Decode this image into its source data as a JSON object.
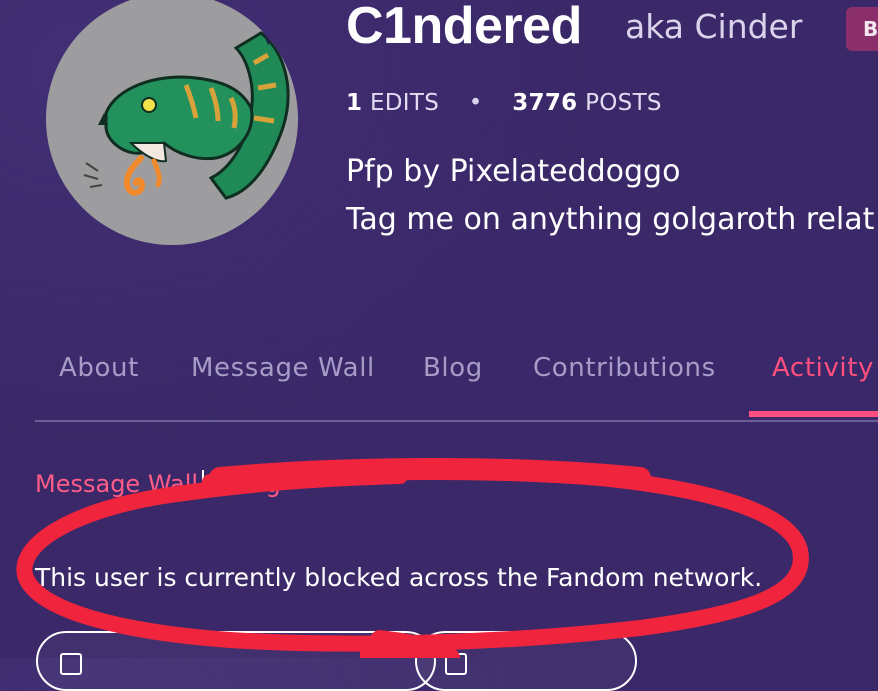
{
  "profile": {
    "username": "C1ndered",
    "aka_word": "aka",
    "aka_name": "Cinder",
    "badge": "B",
    "edits_count": "1",
    "edits_label": "EDITS",
    "separator": "•",
    "posts_count": "3776",
    "posts_label": "POSTS",
    "bio_line1": "Pfp by Pixelateddoggo",
    "bio_line2": "Tag me on anything golgaroth relat"
  },
  "tabs": [
    {
      "label": "About",
      "active": false
    },
    {
      "label": "Message Wall",
      "active": false
    },
    {
      "label": "Blog",
      "active": false
    },
    {
      "label": "Contributions",
      "active": false
    },
    {
      "label": "Activity",
      "active": true
    }
  ],
  "sublinks": {
    "message_wall": "Message Wall",
    "partial_text": "                               e log"
  },
  "notice": {
    "blocked_text": "This user is currently blocked across the Fandom network."
  },
  "colors": {
    "background": "#3a2868",
    "accent": "#ff4f7e",
    "tab_inactive": "#a69cc7",
    "scribble_red": "#f0243c",
    "badge_bg": "#8a2f6a"
  }
}
